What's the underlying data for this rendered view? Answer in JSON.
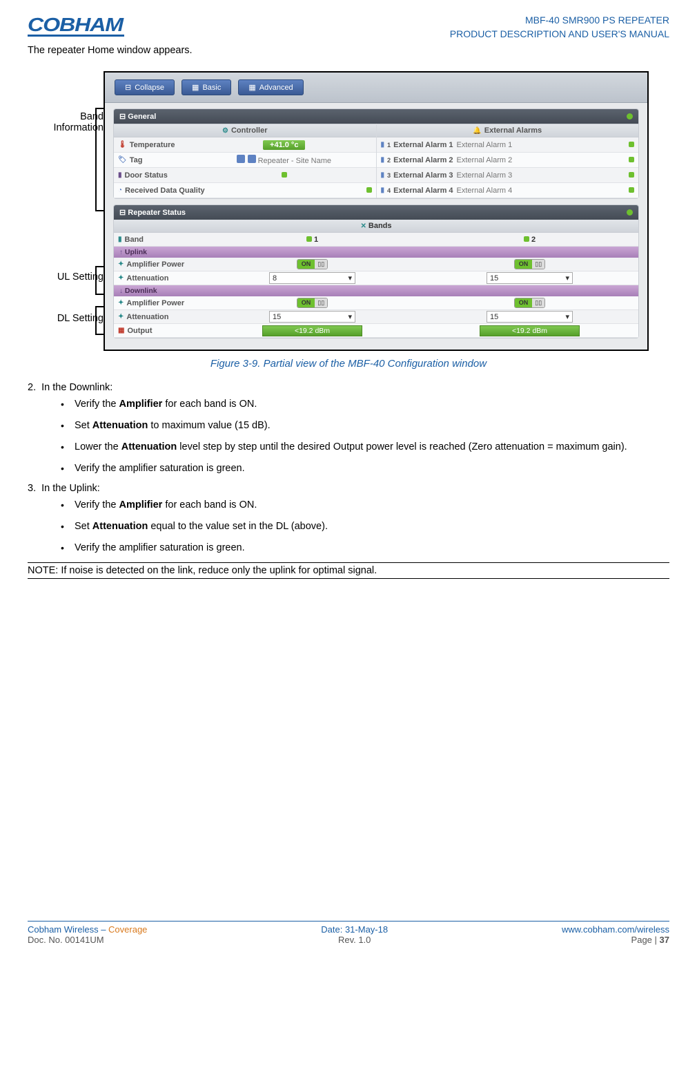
{
  "header": {
    "logo_text": "COBHAM",
    "title_line1": "MBF-40 SMR900 PS REPEATER",
    "title_line2": "PRODUCT DESCRIPTION AND USER'S MANUAL"
  },
  "intro": "The repeater Home window appears.",
  "callouts": {
    "band_info": "Band Information",
    "ul_setting": "UL Setting",
    "dl_setting": "DL Setting"
  },
  "toolbar": {
    "collapse": "Collapse",
    "basic": "Basic",
    "advanced": "Advanced"
  },
  "panels": {
    "general": {
      "title": "General",
      "controller": "Controller",
      "ext_alarms": "External Alarms",
      "temperature_label": "Temperature",
      "temperature_value": "+41.0 °c",
      "tag_label": "Tag",
      "tag_value": "Repeater - Site Name",
      "door_label": "Door Status",
      "rdq_label": "Received Data Quality",
      "alarm_labels": [
        "External Alarm 1",
        "External Alarm 2",
        "External Alarm 3",
        "External Alarm 4"
      ],
      "alarm_vals": [
        "External Alarm 1",
        "External Alarm 2",
        "External Alarm 3",
        "External Alarm 4"
      ]
    },
    "repeater": {
      "title": "Repeater Status",
      "bands_hdr": "Bands",
      "band_label": "Band",
      "band_cols": [
        "1",
        "2"
      ],
      "uplink": "Uplink",
      "downlink": "Downlink",
      "amp_power": "Amplifier Power",
      "attenuation": "Attenuation",
      "output": "Output",
      "on_label": "ON",
      "ul_atten": [
        "8",
        "15"
      ],
      "dl_atten": [
        "15",
        "15"
      ],
      "output_vals": [
        "<19.2 dBm",
        "<19.2 dBm"
      ]
    }
  },
  "figure_caption": "Figure 3-9. Partial view of the MBF-40 Configuration window",
  "steps": {
    "s2_num": "2.",
    "s2_title": "In the Downlink:",
    "s2_b1_pre": "Verify the ",
    "s2_b1_strong": "Amplifier",
    "s2_b1_post": " for each band is ON.",
    "s2_b2_pre": "Set ",
    "s2_b2_strong": "Attenuation",
    "s2_b2_post": " to maximum value (15 dB).",
    "s2_b3_pre": "Lower the ",
    "s2_b3_strong": "Attenuation",
    "s2_b3_post": " level step by step until the desired Output power level is reached (Zero attenuation = maximum gain).",
    "s2_b4": "Verify the amplifier saturation is green.",
    "s3_num": "3.",
    "s3_title": "In the Uplink:",
    "s3_b1_pre": "Verify the ",
    "s3_b1_strong": "Amplifier",
    "s3_b1_post": " for each band is ON.",
    "s3_b2_pre": "Set ",
    "s3_b2_strong": "Attenuation",
    "s3_b2_post": " equal to the value set in the DL (above).",
    "s3_b3": "Verify the amplifier saturation is green."
  },
  "note": "NOTE: If noise is detected on the link, reduce only the uplink for optimal signal.",
  "footer": {
    "brand_pre": "Cobham Wireless – ",
    "brand_cov": "Coverage",
    "docno": "Doc. No. 00141UM",
    "date": "Date: 31-May-18",
    "rev": "Rev. 1.0",
    "url": "www.cobham.com/wireless",
    "page_pre": "Page | ",
    "page_no": "37"
  }
}
